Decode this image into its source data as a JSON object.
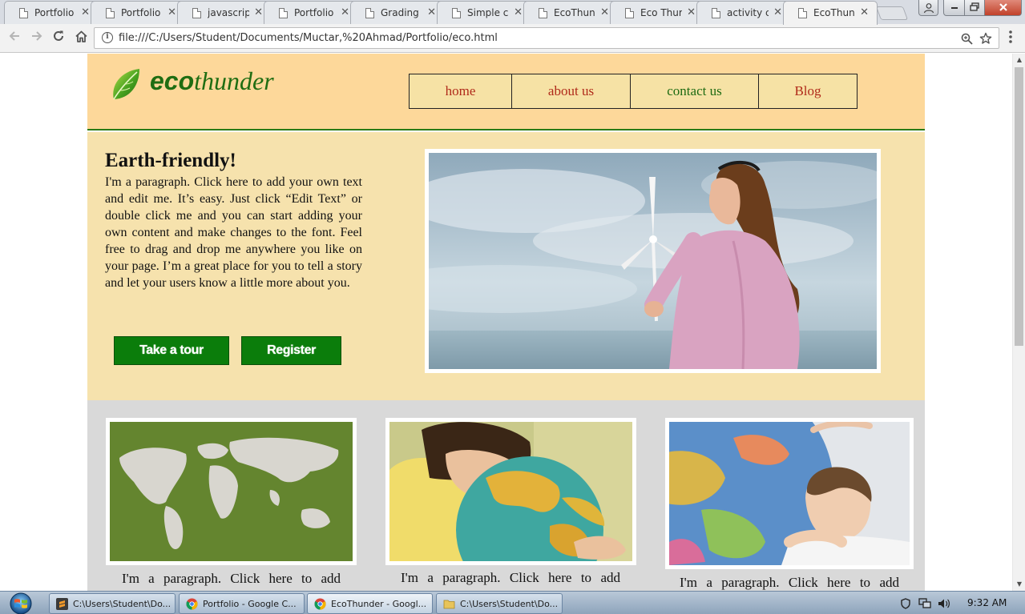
{
  "browser": {
    "tabs": [
      {
        "title": "Portfolio",
        "active": false
      },
      {
        "title": "Portfolio",
        "active": false
      },
      {
        "title": "javascript",
        "active": false
      },
      {
        "title": "Portfolio",
        "active": false
      },
      {
        "title": "Grading",
        "active": false
      },
      {
        "title": "Simple c",
        "active": false
      },
      {
        "title": "EcoThun",
        "active": false
      },
      {
        "title": "Eco Thur",
        "active": false
      },
      {
        "title": "activity c",
        "active": false
      },
      {
        "title": "EcoThun",
        "active": true
      }
    ],
    "close_glyph": "✕",
    "address": "file:///C:/Users/Student/Documents/Muctar,%20Ahmad/Portfolio/eco.html",
    "icons": {
      "back": "arrow-left-icon",
      "forward": "arrow-right-icon",
      "reload": "reload-icon",
      "home": "home-icon",
      "info": "info-icon",
      "zoom": "zoom-icon",
      "bookmark": "star-icon",
      "menu": "kebab-menu-icon"
    }
  },
  "site": {
    "logo": {
      "eco": "eco",
      "thunder": "thunder"
    },
    "nav": [
      {
        "label": "home",
        "color": "#b02a1a"
      },
      {
        "label": "about us",
        "color": "#b02a1a"
      },
      {
        "label": "contact us",
        "color": "#1e6b12"
      },
      {
        "label": "Blog",
        "color": "#b02a1a"
      }
    ],
    "hero": {
      "title": "Earth-friendly!",
      "paragraph": "I'm a paragraph. Click here to add your own text and edit me. It’s easy. Just click “Edit Text” or double click me and you can start adding your own content and make changes to the font. Feel free to drag and drop me anywhere you like on your page. I’m a great place for you to tell a story and let your users know a little more about you.",
      "buttons": {
        "tour": "Take a tour",
        "register": "Register"
      }
    },
    "cards": [
      {
        "text": "I'm a paragraph. Click here to add"
      },
      {
        "text": "I'm a paragraph. Click here to add"
      },
      {
        "text": "I'm a paragraph. Click here to add"
      }
    ],
    "colors": {
      "header_bg": "#fdd89a",
      "hero_bg": "#f6e2ad",
      "features_bg": "#d9d9d9",
      "accent_green": "#0b7d0b"
    }
  },
  "taskbar": {
    "tasks": [
      {
        "label": "C:\\Users\\Student\\Do...",
        "icon": "sublime-text-icon"
      },
      {
        "label": "Portfolio - Google C...",
        "icon": "chrome-icon"
      },
      {
        "label": "EcoThunder - Googl...",
        "icon": "chrome-icon"
      },
      {
        "label": "C:\\Users\\Student\\Do...",
        "icon": "folder-icon"
      }
    ],
    "clock": "9:32 AM"
  }
}
